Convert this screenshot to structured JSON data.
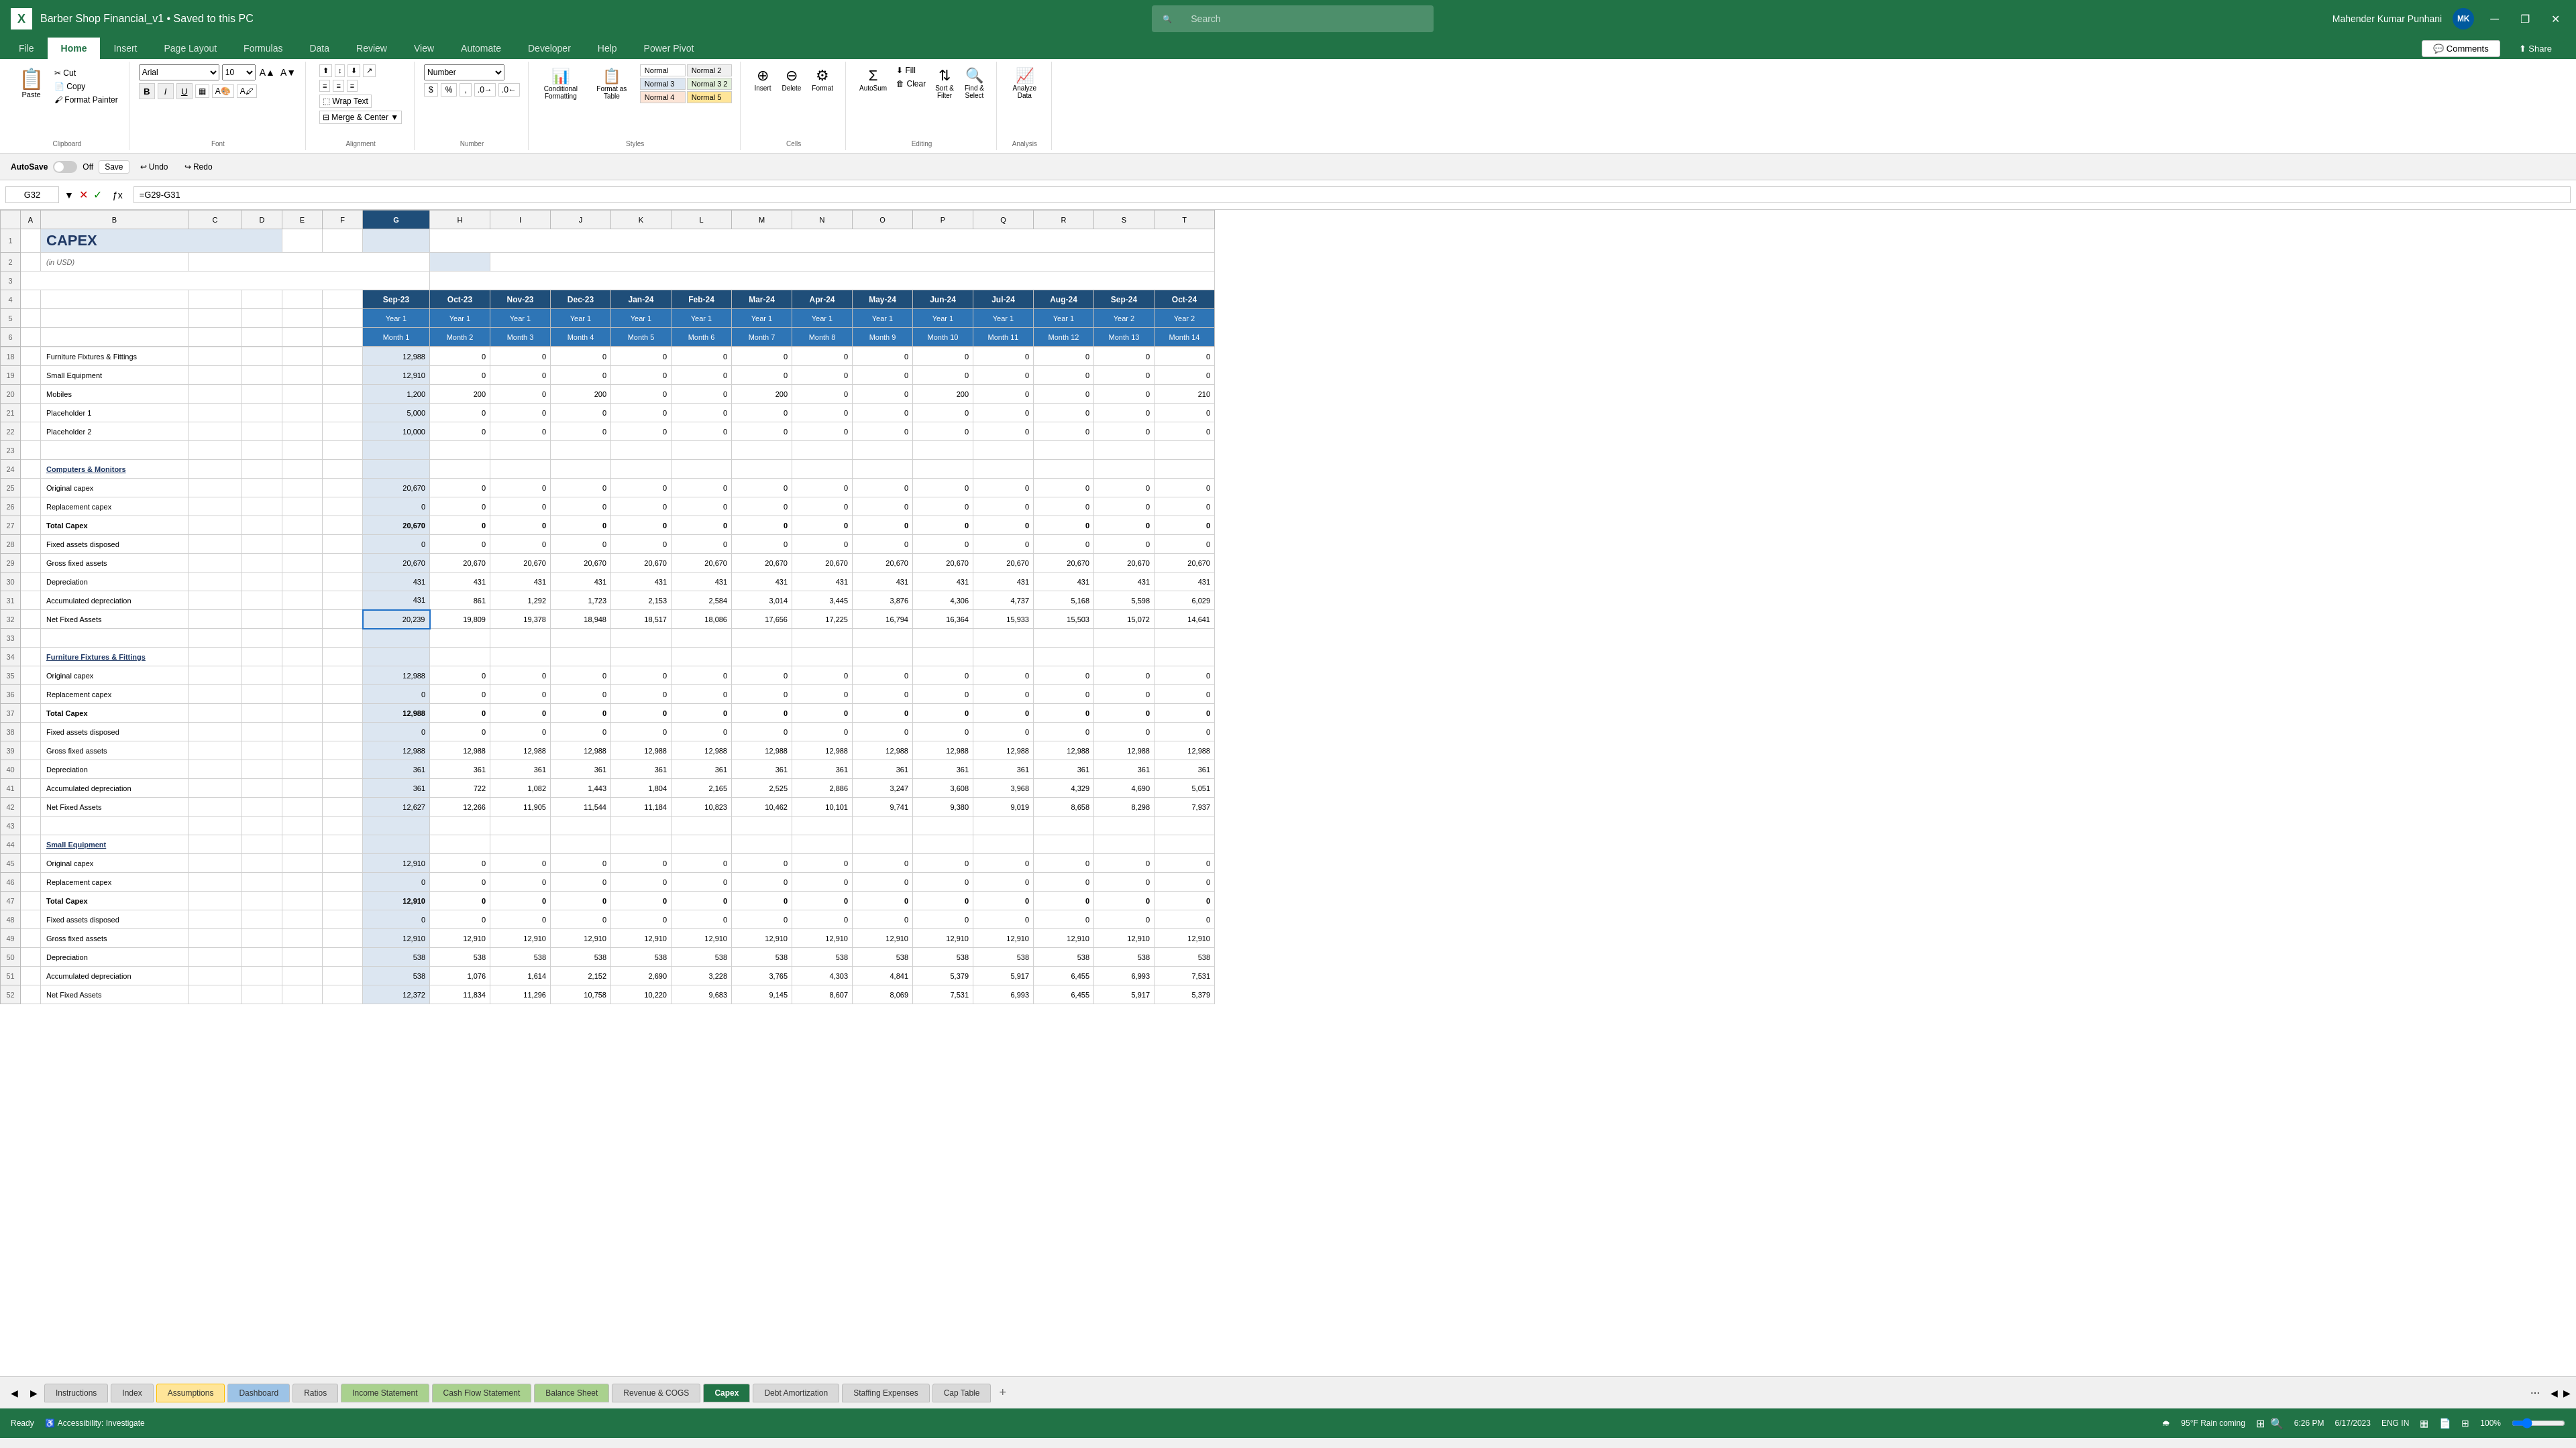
{
  "titleBar": {
    "appIcon": "X",
    "fileTitle": "Barber Shop Financial_v1 • Saved to this PC",
    "searchPlaceholder": "Search",
    "userName": "Mahender Kumar Punhani",
    "userInitials": "MK",
    "windowControls": [
      "minimize",
      "restore",
      "close"
    ]
  },
  "ribbon": {
    "tabs": [
      "File",
      "Home",
      "Insert",
      "Page Layout",
      "Formulas",
      "Data",
      "Review",
      "View",
      "Automate",
      "Developer",
      "Help",
      "Power Pivot"
    ],
    "activeTab": "Home",
    "groups": {
      "clipboard": {
        "label": "Clipboard",
        "buttons": [
          "Paste",
          "Cut",
          "Copy",
          "Format Painter"
        ]
      },
      "font": {
        "label": "Font",
        "fontName": "Arial",
        "fontSize": "10",
        "buttons": [
          "Bold",
          "Italic",
          "Underline"
        ]
      },
      "alignment": {
        "label": "Alignment",
        "buttons": [
          "Wrap Text",
          "Merge & Center"
        ]
      },
      "number": {
        "label": "Number",
        "format": "Number",
        "buttons": [
          "$",
          "%",
          "Comma",
          "Increase Decimal",
          "Decrease Decimal"
        ]
      },
      "styles": {
        "label": "Styles",
        "buttons": [
          "Conditional Formatting",
          "Format as Table"
        ],
        "styles": [
          "Normal",
          "Normal 2",
          "Normal 3",
          "Normal 3 2",
          "Normal 4",
          "Normal 5"
        ]
      },
      "cells": {
        "label": "Cells",
        "buttons": [
          "Insert",
          "Delete",
          "Format"
        ]
      },
      "editing": {
        "label": "Editing",
        "buttons": [
          "AutoSum",
          "Fill",
          "Clear",
          "Sort & Filter",
          "Find & Select"
        ]
      },
      "analysis": {
        "label": "Analysis",
        "buttons": [
          "Analyze Data"
        ]
      }
    }
  },
  "formulaBar": {
    "cellRef": "G32",
    "formula": "=G29-G31"
  },
  "autosave": {
    "label": "AutoSave",
    "state": "Off",
    "saveLabel": "Save",
    "undoLabel": "Undo",
    "redoLabel": "Redo"
  },
  "columns": {
    "headers": [
      "A",
      "B",
      "C",
      "D",
      "E",
      "F",
      "G",
      "H",
      "I",
      "J",
      "K",
      "L",
      "M",
      "N",
      "O",
      "P",
      "Q",
      "R",
      "S",
      "T"
    ],
    "widths": [
      30,
      200,
      220,
      80,
      70,
      70,
      110,
      100,
      100,
      100,
      100,
      100,
      100,
      100,
      100,
      100,
      100,
      100,
      100,
      100
    ]
  },
  "sheetData": {
    "title": "CAPEX",
    "subtitle": "(in USD)",
    "monthHeaders": [
      "Sep-23",
      "Oct-23",
      "Nov-23",
      "Dec-23",
      "Jan-24",
      "Feb-24",
      "Mar-24",
      "Apr-24",
      "May-24",
      "Jun-24",
      "Jul-24",
      "Aug-24",
      "Sep-24",
      "Oct-24"
    ],
    "yearLabels": [
      "Year 1",
      "Year 1",
      "Year 1",
      "Year 1",
      "Year 1",
      "Year 1",
      "Year 1",
      "Year 1",
      "Year 1",
      "Year 1",
      "Year 1",
      "Year 1",
      "Year 2",
      "Year 2"
    ],
    "monthLabels": [
      "Month 1",
      "Month 2",
      "Month 3",
      "Month 4",
      "Month 5",
      "Month 6",
      "Month 7",
      "Month 8",
      "Month 9",
      "Month 10",
      "Month 11",
      "Month 12",
      "Month 13",
      "Month 14"
    ],
    "rows": [
      {
        "rowNum": 18,
        "label": "Furniture Fixtures & Fittings",
        "values": [
          12988,
          0,
          0,
          0,
          0,
          0,
          0,
          0,
          0,
          0,
          0,
          0,
          0,
          0
        ]
      },
      {
        "rowNum": 19,
        "label": "Small Equipment",
        "values": [
          12910,
          0,
          0,
          0,
          0,
          0,
          0,
          0,
          0,
          0,
          0,
          0,
          0,
          0
        ]
      },
      {
        "rowNum": 20,
        "label": "Mobiles",
        "values": [
          1200,
          200,
          0,
          200,
          0,
          0,
          200,
          0,
          0,
          200,
          0,
          0,
          0,
          210
        ]
      },
      {
        "rowNum": 21,
        "label": "Placeholder 1",
        "values": [
          5000,
          0,
          0,
          0,
          0,
          0,
          0,
          0,
          0,
          0,
          0,
          0,
          0,
          0
        ]
      },
      {
        "rowNum": 22,
        "label": "Placeholder 2",
        "values": [
          10000,
          0,
          0,
          0,
          0,
          0,
          0,
          0,
          0,
          0,
          0,
          0,
          0,
          0
        ]
      },
      {
        "rowNum": 23,
        "label": "",
        "values": [
          "",
          "",
          "",
          "",
          "",
          "",
          "",
          "",
          "",
          "",
          "",
          "",
          "",
          ""
        ]
      },
      {
        "rowNum": 24,
        "label": "Computers & Monitors",
        "values": [
          "",
          "",
          "",
          "",
          "",
          "",
          "",
          "",
          "",
          "",
          "",
          "",
          "",
          ""
        ],
        "isSection": true
      },
      {
        "rowNum": 25,
        "label": "Original capex",
        "values": [
          20670,
          0,
          0,
          0,
          0,
          0,
          0,
          0,
          0,
          0,
          0,
          0,
          0,
          0
        ]
      },
      {
        "rowNum": 26,
        "label": "Replacement capex",
        "values": [
          0,
          0,
          0,
          0,
          0,
          0,
          0,
          0,
          0,
          0,
          0,
          0,
          0,
          0
        ]
      },
      {
        "rowNum": 27,
        "label": "Total Capex",
        "values": [
          20670,
          0,
          0,
          0,
          0,
          0,
          0,
          0,
          0,
          0,
          0,
          0,
          0,
          0
        ],
        "isBold": true
      },
      {
        "rowNum": 28,
        "label": "Fixed assets disposed",
        "values": [
          0,
          0,
          0,
          0,
          0,
          0,
          0,
          0,
          0,
          0,
          0,
          0,
          0,
          0
        ]
      },
      {
        "rowNum": 29,
        "label": "Gross fixed assets",
        "values": [
          20670,
          20670,
          20670,
          20670,
          20670,
          20670,
          20670,
          20670,
          20670,
          20670,
          20670,
          20670,
          20670,
          20670
        ]
      },
      {
        "rowNum": 30,
        "label": "Depreciation",
        "values": [
          431,
          431,
          431,
          431,
          431,
          431,
          431,
          431,
          431,
          431,
          431,
          431,
          431,
          431
        ]
      },
      {
        "rowNum": 31,
        "label": "Accumulated depreciation",
        "values": [
          431,
          861,
          1292,
          1723,
          2153,
          2584,
          3014,
          3445,
          3876,
          4306,
          4737,
          5168,
          5598,
          6029
        ]
      },
      {
        "rowNum": 32,
        "label": "Net Fixed Assets",
        "values": [
          20239,
          19809,
          19378,
          18948,
          18517,
          18086,
          17656,
          17225,
          16794,
          16364,
          15933,
          15503,
          15072,
          14641
        ],
        "isSelected": true
      },
      {
        "rowNum": 33,
        "label": "",
        "values": [
          "",
          "",
          "",
          "",
          "",
          "",
          "",
          "",
          "",
          "",
          "",
          "",
          "",
          ""
        ]
      },
      {
        "rowNum": 34,
        "label": "Furniture Fixtures & Fittings",
        "values": [
          "",
          "",
          "",
          "",
          "",
          "",
          "",
          "",
          "",
          "",
          "",
          "",
          "",
          ""
        ],
        "isSection": true
      },
      {
        "rowNum": 35,
        "label": "Original capex",
        "values": [
          12988,
          0,
          0,
          0,
          0,
          0,
          0,
          0,
          0,
          0,
          0,
          0,
          0,
          0
        ]
      },
      {
        "rowNum": 36,
        "label": "Replacement capex",
        "values": [
          0,
          0,
          0,
          0,
          0,
          0,
          0,
          0,
          0,
          0,
          0,
          0,
          0,
          0
        ]
      },
      {
        "rowNum": 37,
        "label": "Total Capex",
        "values": [
          12988,
          0,
          0,
          0,
          0,
          0,
          0,
          0,
          0,
          0,
          0,
          0,
          0,
          0
        ],
        "isBold": true
      },
      {
        "rowNum": 38,
        "label": "Fixed assets disposed",
        "values": [
          0,
          0,
          0,
          0,
          0,
          0,
          0,
          0,
          0,
          0,
          0,
          0,
          0,
          0
        ]
      },
      {
        "rowNum": 39,
        "label": "Gross fixed assets",
        "values": [
          12988,
          12988,
          12988,
          12988,
          12988,
          12988,
          12988,
          12988,
          12988,
          12988,
          12988,
          12988,
          12988,
          12988
        ]
      },
      {
        "rowNum": 40,
        "label": "Depreciation",
        "values": [
          361,
          361,
          361,
          361,
          361,
          361,
          361,
          361,
          361,
          361,
          361,
          361,
          361,
          361
        ]
      },
      {
        "rowNum": 41,
        "label": "Accumulated depreciation",
        "values": [
          361,
          722,
          1082,
          1443,
          1804,
          2165,
          2525,
          2886,
          3247,
          3608,
          3968,
          4329,
          4690,
          5051
        ]
      },
      {
        "rowNum": 42,
        "label": "Net Fixed Assets",
        "values": [
          12627,
          12266,
          11905,
          11544,
          11184,
          10823,
          10462,
          10101,
          9741,
          9380,
          9019,
          8658,
          8298,
          7937
        ]
      },
      {
        "rowNum": 43,
        "label": "",
        "values": [
          "",
          "",
          "",
          "",
          "",
          "",
          "",
          "",
          "",
          "",
          "",
          "",
          "",
          ""
        ]
      },
      {
        "rowNum": 44,
        "label": "Small Equipment",
        "values": [
          "",
          "",
          "",
          "",
          "",
          "",
          "",
          "",
          "",
          "",
          "",
          "",
          "",
          ""
        ],
        "isSection": true
      },
      {
        "rowNum": 45,
        "label": "Original capex",
        "values": [
          12910,
          0,
          0,
          0,
          0,
          0,
          0,
          0,
          0,
          0,
          0,
          0,
          0,
          0
        ]
      },
      {
        "rowNum": 46,
        "label": "Replacement capex",
        "values": [
          0,
          0,
          0,
          0,
          0,
          0,
          0,
          0,
          0,
          0,
          0,
          0,
          0,
          0
        ]
      },
      {
        "rowNum": 47,
        "label": "Total Capex",
        "values": [
          12910,
          0,
          0,
          0,
          0,
          0,
          0,
          0,
          0,
          0,
          0,
          0,
          0,
          0
        ],
        "isBold": true
      },
      {
        "rowNum": 48,
        "label": "Fixed assets disposed",
        "values": [
          0,
          0,
          0,
          0,
          0,
          0,
          0,
          0,
          0,
          0,
          0,
          0,
          0,
          0
        ]
      },
      {
        "rowNum": 49,
        "label": "Gross fixed assets",
        "values": [
          12910,
          12910,
          12910,
          12910,
          12910,
          12910,
          12910,
          12910,
          12910,
          12910,
          12910,
          12910,
          12910,
          12910
        ]
      },
      {
        "rowNum": 50,
        "label": "Depreciation",
        "values": [
          538,
          538,
          538,
          538,
          538,
          538,
          538,
          538,
          538,
          538,
          538,
          538,
          538,
          538
        ]
      },
      {
        "rowNum": 51,
        "label": "Accumulated depreciation",
        "values": [
          538,
          1076,
          1614,
          2152,
          2690,
          3228,
          3765,
          4303,
          4841,
          5379,
          5917,
          6455,
          6993,
          7531
        ]
      },
      {
        "rowNum": 52,
        "label": "Net Fixed Assets",
        "values": [
          12372,
          11834,
          11296,
          10758,
          10220,
          9683,
          9145,
          8607,
          8069,
          7531,
          6993,
          6455,
          5917,
          5379
        ]
      }
    ]
  },
  "sheets": {
    "tabs": [
      {
        "label": "Instructions",
        "color": "default"
      },
      {
        "label": "Index",
        "color": "default"
      },
      {
        "label": "Assumptions",
        "color": "yellow",
        "active": false
      },
      {
        "label": "Dashboard",
        "color": "blue"
      },
      {
        "label": "Ratios",
        "color": "default"
      },
      {
        "label": "Income Statement",
        "color": "green"
      },
      {
        "label": "Cash Flow Statement",
        "color": "green"
      },
      {
        "label": "Balance Sheet",
        "color": "green"
      },
      {
        "label": "Revenue & COGS",
        "color": "default"
      },
      {
        "label": "Capex",
        "color": "green",
        "active": true
      },
      {
        "label": "Debt Amortization",
        "color": "default"
      },
      {
        "label": "Staffing Expenses",
        "color": "default"
      },
      {
        "label": "Cap Table",
        "color": "default"
      }
    ]
  },
  "statusBar": {
    "readyLabel": "Ready",
    "accessibilityLabel": "Accessibility: Investigate",
    "weatherLabel": "95°F Rain coming",
    "searchLabel": "Search",
    "timeLabel": "6:26 PM",
    "dateLabel": "6/17/2023",
    "langLabel": "ENG IN",
    "zoomLevel": "100%",
    "viewIcons": [
      "normal-view",
      "page-layout-view",
      "page-break-view"
    ]
  },
  "comments": {
    "label": "Comments"
  },
  "share": {
    "label": "Share"
  }
}
